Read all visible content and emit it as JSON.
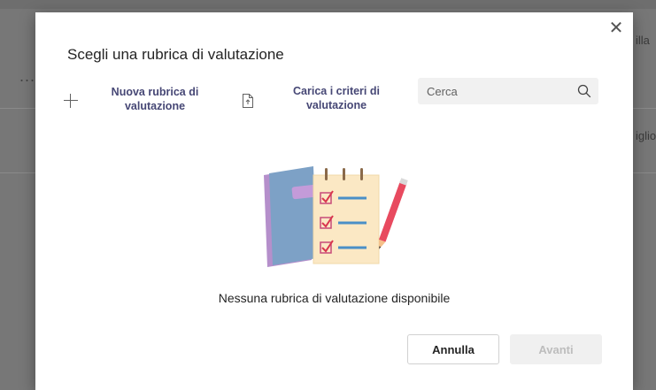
{
  "background": {
    "ellipsis": "...",
    "right_text_1": "illa",
    "right_text_2": "iglio"
  },
  "dialog": {
    "title": "Scegli una rubrica di valutazione",
    "close_glyph": "✕",
    "actions": {
      "new_rubric": {
        "label_line1": "Nuova rubrica di",
        "label_line2": "valutazione",
        "icon": "plus-icon"
      },
      "upload_criteria": {
        "label_line1": "Carica i criteri di",
        "label_line2": "valutazione",
        "icon": "upload-document-icon"
      }
    },
    "search": {
      "placeholder": "Cerca",
      "value": "",
      "icon": "search-icon"
    },
    "empty_state": {
      "message": "Nessuna rubrica di valutazione disponibile",
      "illustration": "notebook-checklist-pencil-illustration"
    },
    "buttons": {
      "cancel": "Annulla",
      "next": "Avanti"
    }
  },
  "colors": {
    "accent": "#464775",
    "overlay": "#7c7c7c",
    "disabled_text": "#bdbdbd"
  }
}
